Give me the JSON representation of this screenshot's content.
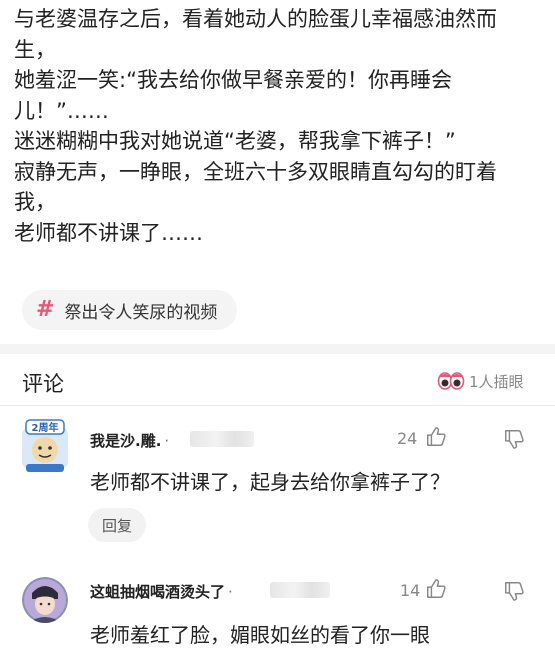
{
  "post": {
    "lines": [
      "与老婆温存之后，看着她动人的脸蛋儿幸福感油然而",
      "生，",
      "她羞涩一笑:“我去给你做早餐亲爱的！你再睡会",
      "儿！”……",
      "迷迷糊糊中我对她说道“老婆，帮我拿下裤子！”",
      "寂静无声，一睁眼，全班六十多双眼睛直勾勾的盯着",
      "我，",
      "老师都不讲课了……"
    ]
  },
  "topic": {
    "label": "祭出令人笑尿的视频"
  },
  "comments_header": {
    "title": "评论",
    "insert_text": "1人插眼"
  },
  "comments": [
    {
      "username": "我是沙.雕.",
      "dot": "·",
      "likes": "24",
      "text": "老师都不讲课了，起身去给你拿裤子了？",
      "reply_label": "回复",
      "badge_text": "2周年"
    },
    {
      "username": "这蛆抽烟喝酒烫头了",
      "dot": "·",
      "likes": "14",
      "text": "老师羞红了脸，媚眼如丝的看了你一眼"
    }
  ],
  "icons": {
    "like": "thumbs-up-icon",
    "dislike": "thumbs-down-icon",
    "eyes": "eyes-icon",
    "topic": "hashtag-icon"
  },
  "colors": {
    "accent": "#e8577a",
    "muted": "#888888"
  }
}
